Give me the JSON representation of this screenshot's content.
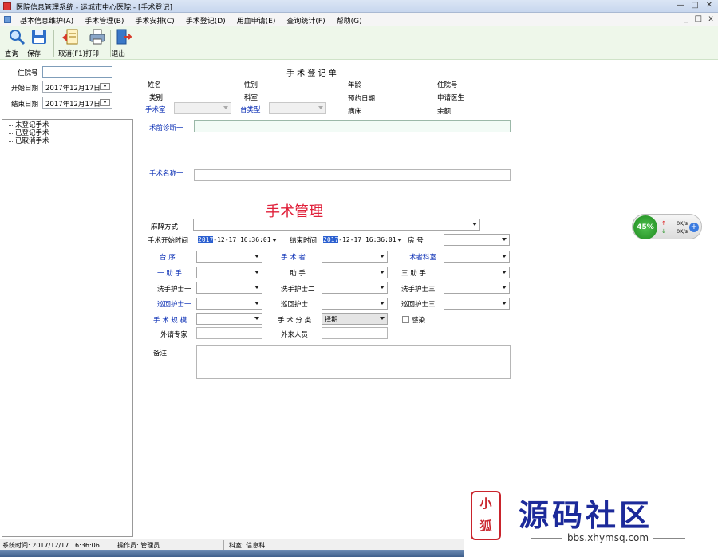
{
  "window": {
    "title": "医院信息管理系统  -  运城市中心医院 - [手术登记]",
    "min": "—",
    "max": "□",
    "close": "✕"
  },
  "menu": {
    "items": [
      "基本信息维护(A)",
      "手术管理(B)",
      "手术安排(C)",
      "手术登记(D)",
      "用血申请(E)",
      "查询统计(F)",
      "帮助(G)"
    ],
    "mdi_min": "_",
    "mdi_max": "□",
    "mdi_close": "x"
  },
  "toolbar": {
    "query": "查询",
    "save": "保存",
    "cancel": "取消(F1)",
    "print": "打印",
    "exit": "退出"
  },
  "left": {
    "inpatient_label": "住院号",
    "start_label": "开始日期",
    "start_value": "2017年12月17日",
    "end_label": "结束日期",
    "end_value": "2017年12月17日",
    "tree": [
      "未登记手术",
      "已登记手术",
      "已取消手术"
    ]
  },
  "form": {
    "title": "手 术 登 记 单",
    "name": "姓名",
    "sex": "性别",
    "age": "年龄",
    "inpatient_no": "住院号",
    "category": "类别",
    "dept": "科室",
    "appointment_date": "预约日期",
    "applicant_doctor": "申请医生",
    "op_room": "手术室",
    "table_type": "台类型",
    "bed": "病床",
    "balance": "余额",
    "pre_diagnosis": "术前诊断一",
    "op_name": "手术名称一",
    "overlay_text": "手术管理",
    "anesthesia": "麻醉方式",
    "start_time_label": "手术开始时间",
    "start_time_sel": "2017",
    "start_time_rest": "-12-17 16:36:01",
    "end_time_label": "结束时间",
    "end_time_sel": "2017",
    "end_time_rest": "-12-17 16:36:01",
    "room_no": "房 号",
    "table_no": "台 序",
    "surgeon": "手 术 者",
    "surgeon_dept": "术者科室",
    "assistant1": "一 助 手",
    "assistant2": "二 助 手",
    "assistant3": "三 助 手",
    "wash_nurse1": "洗手护士一",
    "wash_nurse2": "洗手护士二",
    "wash_nurse3": "洗手护士三",
    "tour_nurse1": "巡回护士一",
    "tour_nurse2": "巡回护士二",
    "tour_nurse3": "巡回护士三",
    "op_scale": "手 术 规 模",
    "op_class": "手 术 分 类",
    "op_class_value": "择期",
    "infection": "感染",
    "external_expert": "外请专家",
    "external_staff": "外来人员",
    "remark": "备注"
  },
  "net_widget": {
    "percent": "45%",
    "percent_value": 45,
    "up_arrow": "↑",
    "down_arrow": "↓",
    "up_rate": "0K/s",
    "down_rate": "0K/s",
    "plus": "+"
  },
  "status": {
    "time": "系统时间: 2017/12/17 16:36:06",
    "operator": "操作员: 管理员",
    "dept": "科室: 信息科"
  },
  "watermark": {
    "seal": "小\n狐",
    "title": "源码社区",
    "url": "bbs.xhymsq.com"
  },
  "colors": {
    "label_blue": "#0b2fb5",
    "toolbar_bg": "#eef7ea",
    "overlay_red": "#e0203a"
  }
}
